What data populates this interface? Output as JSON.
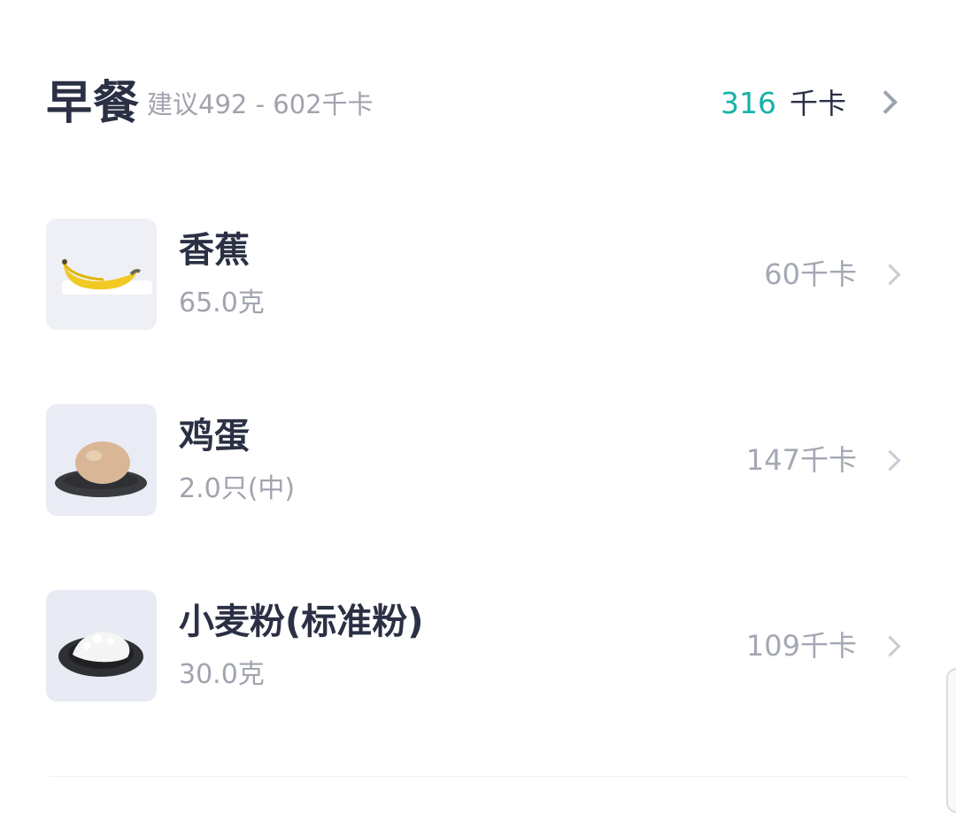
{
  "meal": {
    "title": "早餐",
    "suggested_range": "建议492 - 602千卡",
    "total_value": "316",
    "total_unit": "千卡"
  },
  "foods": [
    {
      "name": "香蕉",
      "amount": "65.0克",
      "calories": "60千卡",
      "image": "banana-image"
    },
    {
      "name": "鸡蛋",
      "amount": "2.0只(中)",
      "calories": "147千卡",
      "image": "egg-image"
    },
    {
      "name": "小麦粉(标准粉)",
      "amount": "30.0克",
      "calories": "109千卡",
      "image": "flour-image"
    }
  ],
  "colors": {
    "accent": "#18b2a6",
    "title_text": "#2b3044",
    "secondary_text": "#a0a4ae"
  },
  "icons": {
    "row_chevron": "chevron-right-icon"
  }
}
